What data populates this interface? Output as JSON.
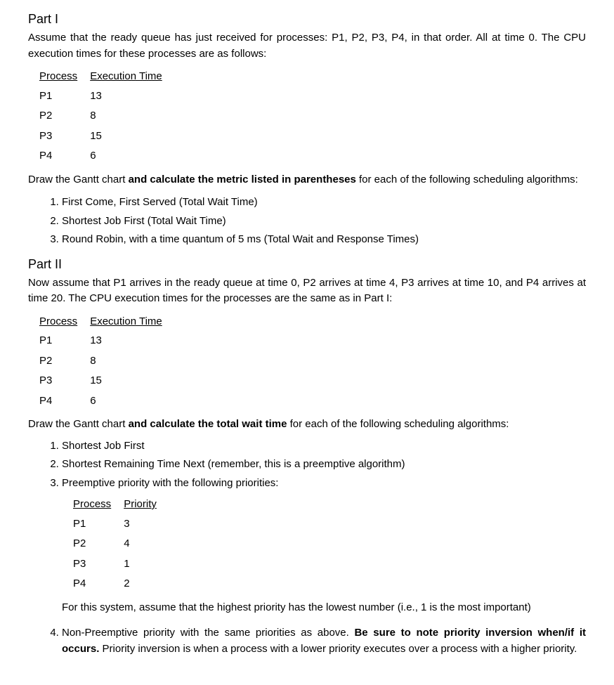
{
  "part1": {
    "heading": "Part I",
    "intro": "Assume that the ready queue has just received for processes: P1, P2, P3, P4, in that order. All at time 0. The CPU execution times for these processes are as follows:",
    "table": {
      "col1": "Process",
      "col2": "Execution Time",
      "rows": [
        {
          "p": "P1",
          "t": "13"
        },
        {
          "p": "P2",
          "t": "8"
        },
        {
          "p": "P3",
          "t": "15"
        },
        {
          "p": "P4",
          "t": "6"
        }
      ]
    },
    "instruction_pre": "Draw the Gantt chart ",
    "instruction_bold": "and calculate the metric listed in parentheses",
    "instruction_post": " for each of the following scheduling algorithms:",
    "items": [
      "First Come, First Served (Total Wait Time)",
      "Shortest Job First (Total Wait Time)",
      "Round Robin, with a time quantum of 5 ms (Total Wait and Response Times)"
    ]
  },
  "part2": {
    "heading": "Part II",
    "intro": "Now assume that P1 arrives in the ready queue at time 0, P2 arrives at time 4, P3 arrives at time 10, and P4 arrives at time 20. The CPU execution times for the processes are the same as in Part I:",
    "table": {
      "col1": "Process",
      "col2": "Execution Time",
      "rows": [
        {
          "p": "P1",
          "t": "13"
        },
        {
          "p": "P2",
          "t": "8"
        },
        {
          "p": "P3",
          "t": "15"
        },
        {
          "p": "P4",
          "t": "6"
        }
      ]
    },
    "instruction_pre": "Draw the Gantt chart ",
    "instruction_bold": "and calculate the total wait time",
    "instruction_post": " for each of the following scheduling algorithms:",
    "items": {
      "i1": "Shortest Job First",
      "i2": "Shortest Remaining Time Next (remember, this is a preemptive algorithm)",
      "i3": "Preemptive priority with the following priorities:",
      "i4_pre": "Non-Preemptive priority with the same priorities as above. ",
      "i4_bold": "Be sure to note priority inversion when/if it occurs.",
      "i4_post": " Priority inversion is when a process with a lower priority executes over a process with a higher priority."
    },
    "priority_table": {
      "col1": "Process",
      "col2": "Priority",
      "rows": [
        {
          "p": "P1",
          "v": "3"
        },
        {
          "p": "P2",
          "v": "4"
        },
        {
          "p": "P3",
          "v": "1"
        },
        {
          "p": "P4",
          "v": "2"
        }
      ]
    },
    "priority_note": "For this system, assume that the highest priority has the lowest number (i.e., 1 is the most important)"
  }
}
